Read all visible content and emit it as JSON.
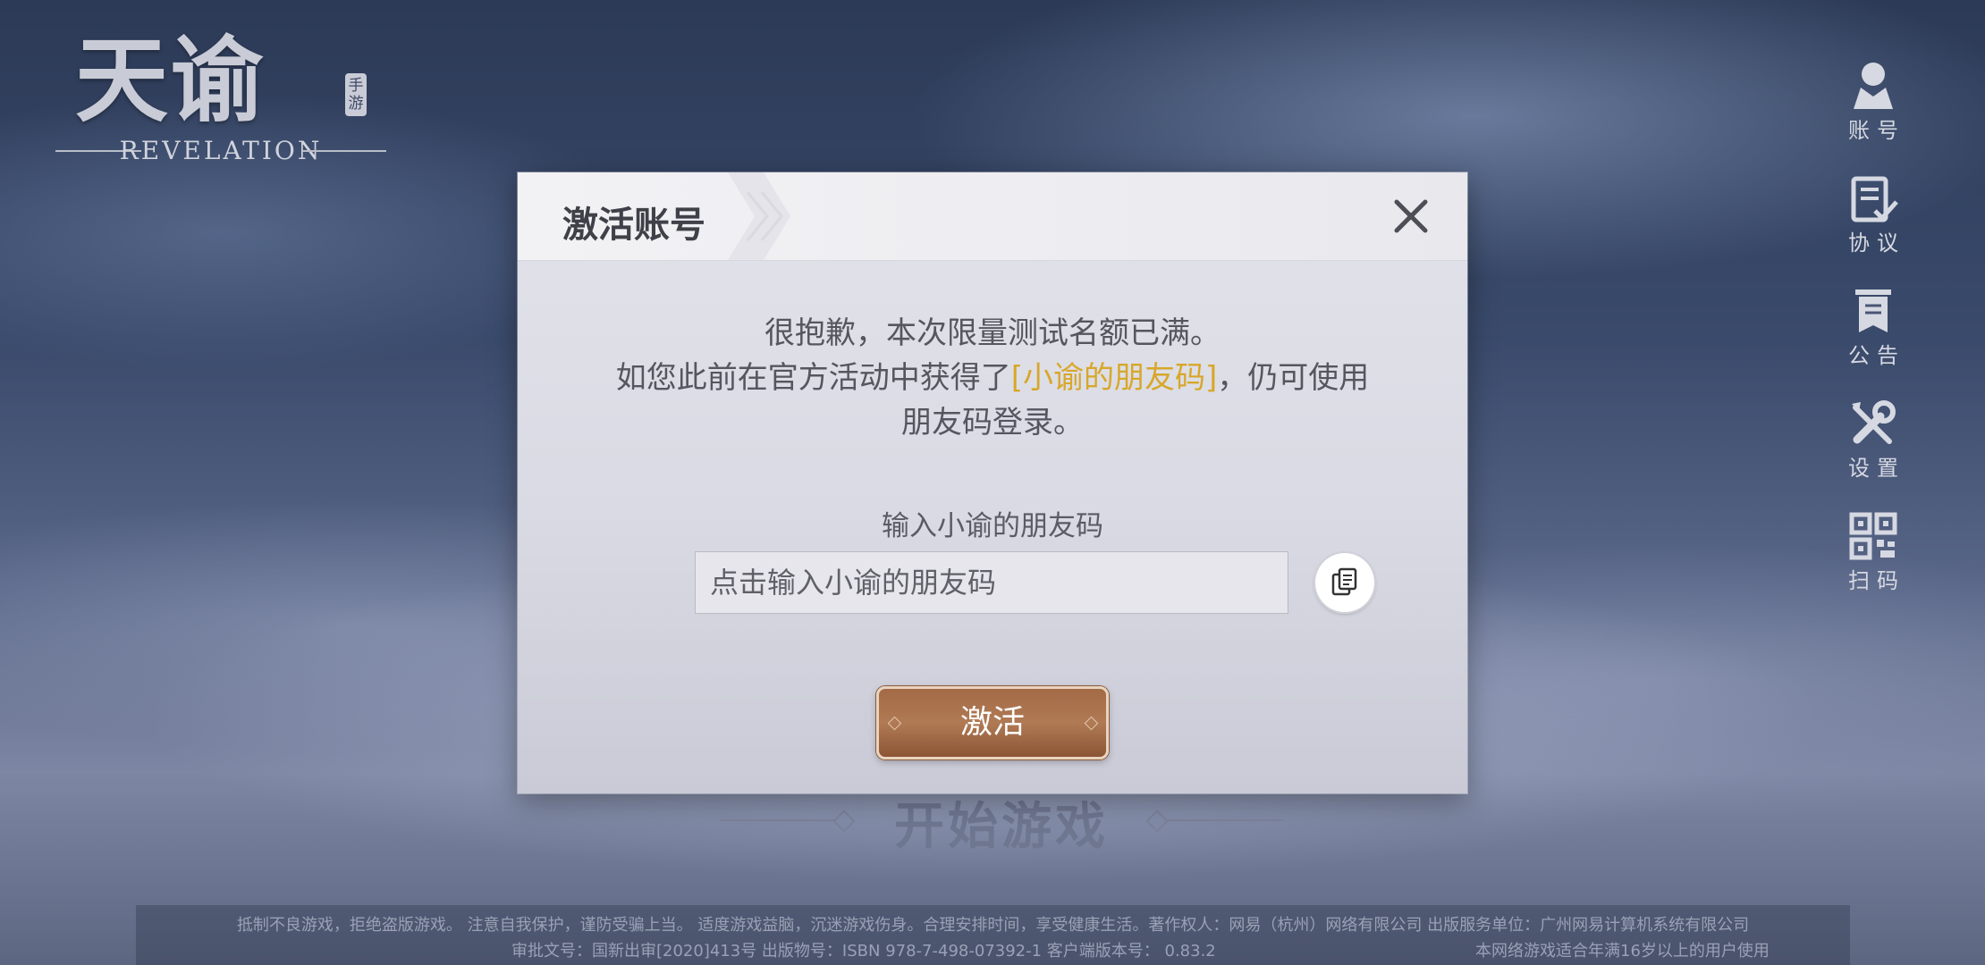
{
  "logo": {
    "title": "天谕",
    "badge": "手游",
    "subtitle": "REVELATION"
  },
  "side_menu": [
    {
      "label": "账号",
      "icon": "user-icon"
    },
    {
      "label": "协议",
      "icon": "agreement-icon"
    },
    {
      "label": "公告",
      "icon": "announcement-icon"
    },
    {
      "label": "设置",
      "icon": "settings-icon"
    },
    {
      "label": "扫码",
      "icon": "qr-code-icon"
    }
  ],
  "start_game": "开始游戏",
  "dialog": {
    "title": "激活账号",
    "message_line1": "很抱歉，本次限量测试名额已满。",
    "message_line2_prefix": "如您此前在官方活动中获得了",
    "message_highlight": "[小谕的朋友码]",
    "message_line2_suffix": "，仍可使用",
    "message_line3": "朋友码登录。",
    "input_label": "输入小谕的朋友码",
    "input_placeholder": "点击输入小谕的朋友码",
    "input_value": "",
    "activate_label": "激活"
  },
  "footer": {
    "line1": "抵制不良游戏，拒绝盗版游戏。 注意自我保护，谨防受骗上当。 适度游戏益脑，沉迷游戏伤身。合理安排时间，享受健康生活。著作权人：网易（杭州）网络有限公司 出版服务单位：广州网易计算机系统有限公司",
    "line2": "审批文号：国新出审[2020]413号 出版物号：ISBN 978-7-498-07392-1  客户端版本号： 0.83.2",
    "age_notice": "本网络游戏适合年满16岁以上的用户使用"
  },
  "colors": {
    "highlight": "#d8a72a",
    "activate_button": "#a36a46"
  }
}
